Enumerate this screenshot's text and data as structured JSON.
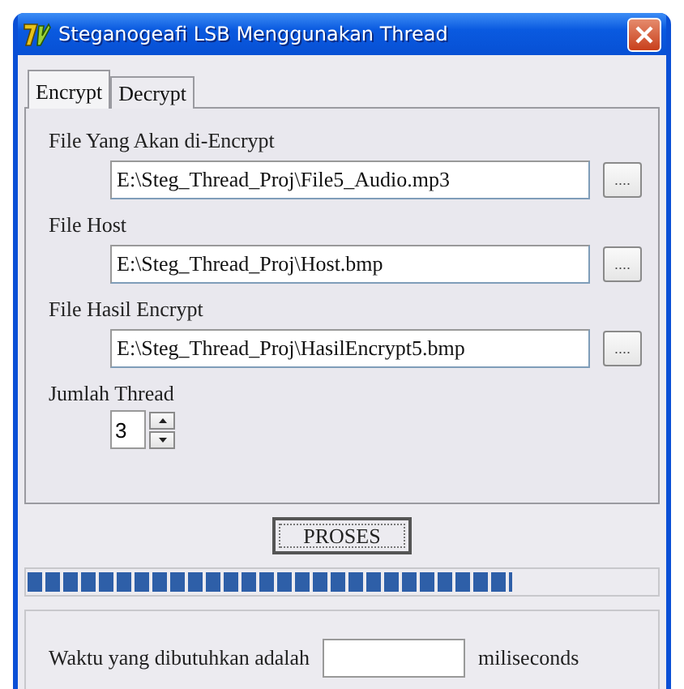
{
  "window": {
    "title": "Steganogeafi LSB Menggunakan Thread"
  },
  "tabs": [
    {
      "label": "Encrypt",
      "selected": true
    },
    {
      "label": "Decrypt",
      "selected": false
    }
  ],
  "file_fields": [
    {
      "label": "File Yang Akan di-Encrypt",
      "value": "E:\\Steg_Thread_Proj\\File5_Audio.mp3",
      "browse_label": "...."
    },
    {
      "label": "File Host",
      "value": "E:\\Steg_Thread_Proj\\Host.bmp",
      "browse_label": "...."
    },
    {
      "label": "File Hasil Encrypt",
      "value": "E:\\Steg_Thread_Proj\\HasilEncrypt5.bmp",
      "browse_label": "...."
    }
  ],
  "thread": {
    "label": "Jumlah Thread",
    "value": "3"
  },
  "process_button": "PROSES",
  "progress": {
    "level": 0.77
  },
  "result": {
    "label": "Waktu yang dibutuhkan adalah",
    "unit": "miliseconds"
  }
}
